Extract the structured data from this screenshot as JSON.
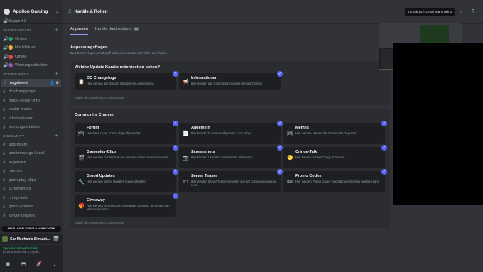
{
  "server": {
    "name": "Apollon Gaming"
  },
  "channels": {
    "support": "Support 3",
    "server_status_cat": "SERVER-STATUS",
    "status_items": [
      {
        "label": "Online",
        "color": "#23a55a"
      },
      {
        "label": "Hochfahren",
        "color": "#f0b232"
      },
      {
        "label": "Offline",
        "color": "#f23f43"
      },
      {
        "label": "Wartungsarbeiten",
        "color": "#9b59b6"
      }
    ],
    "server_infos_cat": "SERVER-INFOS",
    "info_items": [
      "regelwerk",
      "dc-changelogs",
      "gmod-server-info",
      "social-media",
      "informationen",
      "wartungsarbeiten"
    ],
    "community_cat": "COMMUNITY",
    "community_items": [
      "app-forum",
      "abstimmungs-kanal",
      "allgemein",
      "memes",
      "gameplay-clips",
      "screenshots",
      "cringe-talk",
      "gmod-update",
      "server-teasers"
    ]
  },
  "sidebar_bottom": {
    "new_messages": "NEUE UNGELESENE NACHRICHTEN",
    "game": "Car Mechanic Simulat...",
    "voice_status": "Sprachchat verbunden",
    "voice_sub": "|-Gmod Team Talk 1 / Apoll..."
  },
  "topbar": {
    "title": "Kanäle & Rollen",
    "back_label": "Zurück zu",
    "back_channel": "|-Gmod Team Talk 1"
  },
  "tabs": [
    {
      "label": "Anpassen",
      "active": true
    },
    {
      "label": "Kanäle durchstöbern",
      "count": "64"
    }
  ],
  "intro": {
    "title": "Anpassungsfragen",
    "sub": "Beantworte Fragen, um Zugriff auf weitere Kanäle und Rollen zu erhalten."
  },
  "q1": {
    "title": "Welche Update Kanäle möchtest du sehen?",
    "footer": "Wähle alle zutreffenden Optionen aus",
    "cards": [
      {
        "name": "DC Changelogs",
        "desc": "Hier werden alle Discord Updates rein geschrieben",
        "icon": "📋"
      },
      {
        "name": "Informationen",
        "desc": "Hier werden alle Community Updates reingeschrieben",
        "icon": "📢"
      }
    ]
  },
  "q2": {
    "title": "Community Channel",
    "footer": "Wähle alle zutreffenden Optionen aus",
    "cards": [
      {
        "name": "Forum",
        "desc": "Hier kann unser Forum abgerufgt werden",
        "icon": "🗂"
      },
      {
        "name": "Allgemein",
        "desc": "Hier kannst du unseren Allgemein Chat sehen",
        "icon": "📄"
      },
      {
        "name": "Memes",
        "desc": "Hier werden Memes der Community Gepostet",
        "icon": "🖼"
      },
      {
        "name": "Gameplay-Clips",
        "desc": "Hier werden Game Clips von unserem Gmod Server Gepostet",
        "icon": "🎬"
      },
      {
        "name": "Screenshots",
        "desc": "Hier können User Ihre Screenshots versenden",
        "icon": "📷"
      },
      {
        "name": "Cringe-Talk",
        "desc": "Hier kannst du über Cringe schreiben",
        "icon": "😬"
      },
      {
        "name": "Gmod Updates",
        "desc": "Hier werden Server Updates reingeschrieben",
        "icon": "🔧"
      },
      {
        "name": "Server Teaser",
        "desc": "Hier werden Server Teaser Gepostet von der Community Leitung & Co.",
        "icon": "🎞"
      },
      {
        "name": "Promo Codes",
        "desc": "Hier werden Promo Codes Gepostet welche man einlösen kann",
        "icon": "🎟"
      },
      {
        "name": "Giveaway",
        "desc": "Hier werden verschiedene Giveaways gepostet, an denen man teilnehmen kann",
        "icon": "🎁"
      }
    ]
  }
}
